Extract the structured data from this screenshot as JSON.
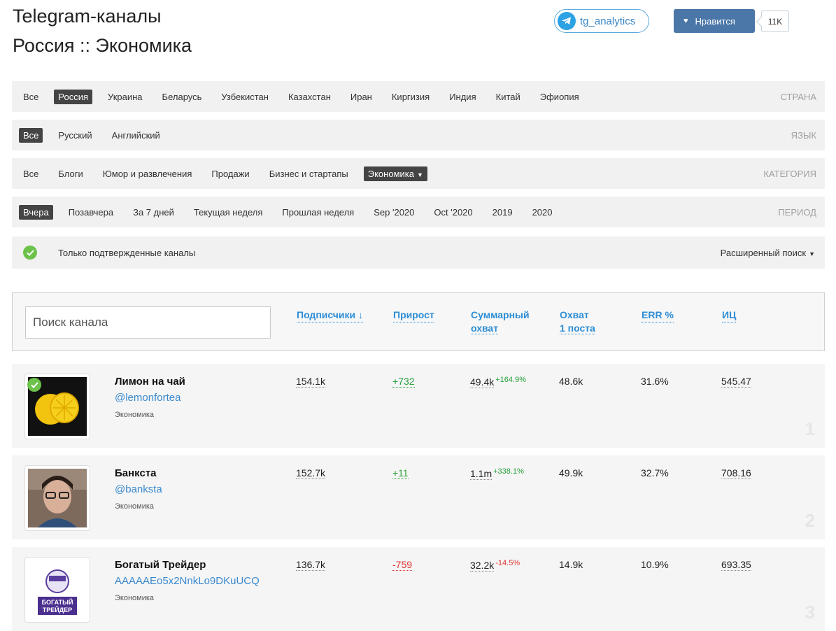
{
  "header": {
    "title_line1": "Telegram-каналы",
    "title_line2": "Россия :: Экономика",
    "tg_button": "tg_analytics",
    "like_button": "Нравится",
    "like_count": "11K"
  },
  "filters": {
    "country": {
      "label": "СТРАНА",
      "items": [
        "Все",
        "Россия",
        "Украина",
        "Беларусь",
        "Узбекистан",
        "Казахстан",
        "Иран",
        "Киргизия",
        "Индия",
        "Китай",
        "Эфиопия"
      ],
      "active": "Россия"
    },
    "language": {
      "label": "ЯЗЫК",
      "items": [
        "Все",
        "Русский",
        "Английский"
      ],
      "active": "Все"
    },
    "category": {
      "label": "КАТЕГОРИЯ",
      "items": [
        "Все",
        "Блоги",
        "Юмор и развлечения",
        "Продажи",
        "Бизнес и стартапы",
        "Экономика"
      ],
      "active": "Экономика"
    },
    "period": {
      "label": "ПЕРИОД",
      "items": [
        "Вчера",
        "Позавчера",
        "За 7 дней",
        "Текущая неделя",
        "Прошлая неделя",
        "Sep '2020",
        "Oct '2020",
        "2019",
        "2020"
      ],
      "active": "Вчера"
    },
    "verified_only": "Только подтвержденные каналы",
    "advanced_search": "Расширенный поиск"
  },
  "table": {
    "search_placeholder": "Поиск канала",
    "columns": {
      "subscribers": "Подписчики ↓",
      "growth": "Прирост",
      "reach_1": "Суммарный",
      "reach_2": "охват",
      "post_reach_1": "Охват",
      "post_reach_2": "1 поста",
      "err": "ERR %",
      "ic": "ИЦ"
    },
    "rows": [
      {
        "name": "Лимон на чай",
        "username": "@lemonfortea",
        "category": "Экономика",
        "subscribers": "154.1k",
        "growth": "+732",
        "growth_sign": "positive",
        "reach": "49.4k",
        "reach_change": "+164.9%",
        "reach_change_sign": "positive",
        "post_reach": "48.6k",
        "err": "31.6%",
        "ic": "545.47",
        "rank": "1",
        "verified": true
      },
      {
        "name": "Банкста",
        "username": "@banksta",
        "category": "Экономика",
        "subscribers": "152.7k",
        "growth": "+11",
        "growth_sign": "positive",
        "reach": "1.1m",
        "reach_change": "+338.1%",
        "reach_change_sign": "positive",
        "post_reach": "49.9k",
        "err": "32.7%",
        "ic": "708.16",
        "rank": "2",
        "verified": false
      },
      {
        "name": "Богатый Трейдер",
        "username": "AAAAAEo5x2NnkLo9DKuUCQ",
        "category": "Экономика",
        "subscribers": "136.7k",
        "growth": "-759",
        "growth_sign": "negative",
        "reach": "32.2k",
        "reach_change": "-14.5%",
        "reach_change_sign": "negative",
        "post_reach": "14.9k",
        "err": "10.9%",
        "ic": "693.35",
        "rank": "3",
        "verified": false
      }
    ]
  },
  "colors": {
    "link": "#2d8dd5",
    "positive": "#27a03a",
    "negative": "#e03232",
    "active_filter": "#444444",
    "like_button": "#4a76a8",
    "telegram": "#2ca2e4"
  }
}
